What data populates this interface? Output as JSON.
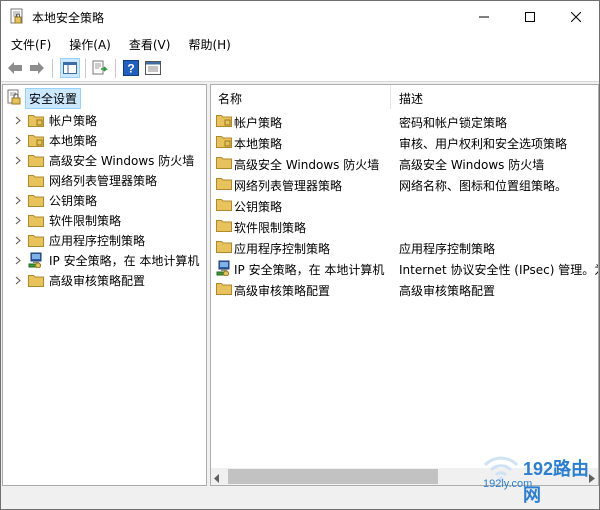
{
  "window": {
    "title": "本地安全策略"
  },
  "menu": [
    "文件(F)",
    "操作(A)",
    "查看(V)",
    "帮助(H)"
  ],
  "tree": {
    "root": "安全设置",
    "items": [
      {
        "label": "帐户策略",
        "expandable": true,
        "icon": "folder-icon"
      },
      {
        "label": "本地策略",
        "expandable": true,
        "icon": "folder-icon"
      },
      {
        "label": "高级安全 Windows 防火墙",
        "expandable": true,
        "icon": "folder-icon"
      },
      {
        "label": "网络列表管理器策略",
        "expandable": false,
        "icon": "folder-icon"
      },
      {
        "label": "公钥策略",
        "expandable": true,
        "icon": "folder-icon"
      },
      {
        "label": "软件限制策略",
        "expandable": true,
        "icon": "folder-icon"
      },
      {
        "label": "应用程序控制策略",
        "expandable": true,
        "icon": "folder-icon"
      },
      {
        "label": "IP 安全策略，在 本地计算机",
        "expandable": true,
        "icon": "ipsec-policy-icon"
      },
      {
        "label": "高级审核策略配置",
        "expandable": true,
        "icon": "folder-icon"
      }
    ]
  },
  "list": {
    "columns": {
      "name": "名称",
      "description": "描述"
    },
    "rows": [
      {
        "name": "帐户策略",
        "description": "密码和帐户锁定策略",
        "icon": "folder-icon"
      },
      {
        "name": "本地策略",
        "description": "审核、用户权利和安全选项策略",
        "icon": "folder-icon"
      },
      {
        "name": "高级安全 Windows 防火墙",
        "description": "高级安全 Windows 防火墙",
        "icon": "folder-icon"
      },
      {
        "name": "网络列表管理器策略",
        "description": "网络名称、图标和位置组策略。",
        "icon": "folder-icon"
      },
      {
        "name": "公钥策略",
        "description": "",
        "icon": "folder-icon"
      },
      {
        "name": "软件限制策略",
        "description": "",
        "icon": "folder-icon"
      },
      {
        "name": "应用程序控制策略",
        "description": "应用程序控制策略",
        "icon": "folder-icon"
      },
      {
        "name": "IP 安全策略，在 本地计算机",
        "description": "Internet 协议安全性 (IPsec) 管理。为",
        "icon": "ipsec-policy-icon"
      },
      {
        "name": "高级审核策略配置",
        "description": "高级审核策略配置",
        "icon": "folder-icon"
      }
    ]
  },
  "watermark": {
    "text": "192路由网",
    "sub": "192ly.com"
  },
  "colors": {
    "selection": "#cce8ff",
    "folder": "#e8c25a",
    "accent": "#2a7fd4"
  }
}
